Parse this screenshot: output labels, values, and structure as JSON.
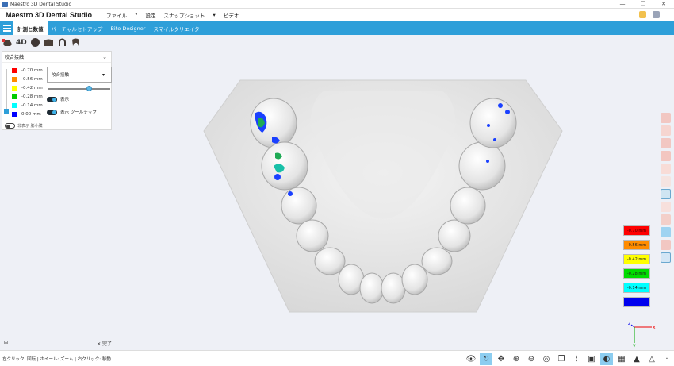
{
  "window": {
    "title": "Maestro 3D Dental Studio",
    "controls": [
      "—",
      "❐",
      "✕"
    ]
  },
  "menubar": {
    "brand": "Maestro 3D Dental Studio",
    "items": [
      "ファイル",
      "?",
      "設定",
      "スナップショット",
      "▾",
      "ビデオ"
    ]
  },
  "tabs": [
    {
      "label": "計測と数値",
      "active": true
    },
    {
      "label": "パーチャルセトアップ",
      "active": false
    },
    {
      "label": "Bite Designer",
      "active": false
    },
    {
      "label": "スマイルクリエイター",
      "active": false
    }
  ],
  "toolrow": {
    "label_4d": "4D"
  },
  "panel": {
    "header": "咬合接触",
    "scale": [
      {
        "value": "-0.70 mm",
        "color": "#ff0000"
      },
      {
        "value": "-0.56 mm",
        "color": "#ff8c00"
      },
      {
        "value": "-0.42 mm",
        "color": "#ffff00"
      },
      {
        "value": "-0.28 mm",
        "color": "#00cc00"
      },
      {
        "value": "-0.14 mm",
        "color": "#00ffff"
      },
      {
        "value": "0.00 mm",
        "color": "#0000ff"
      }
    ],
    "select_value": "咬合接触",
    "toggle_show": "表示",
    "toggle_tooltip": "表示 ツールチップ",
    "bottom_toggle": "非表示 膨小膜",
    "footer_done": "✕ 完了",
    "footer_icon": "⊟"
  },
  "legend": [
    {
      "label": "-0.70 mm",
      "color": "#ff0000"
    },
    {
      "label": "-0.56 mm",
      "color": "#ff8c00"
    },
    {
      "label": "-0.42 mm",
      "color": "#ffff00"
    },
    {
      "label": "-0.28 mm",
      "color": "#00dd00"
    },
    {
      "label": "-0.14 mm",
      "color": "#00ffff"
    },
    {
      "label": "",
      "color": "#0000ee"
    }
  ],
  "axis": {
    "x": "x",
    "y": "y",
    "z": "z"
  },
  "status": {
    "hint": "左クリック: 回転 | ホイール: ズーム | 右クリック: 移動"
  }
}
